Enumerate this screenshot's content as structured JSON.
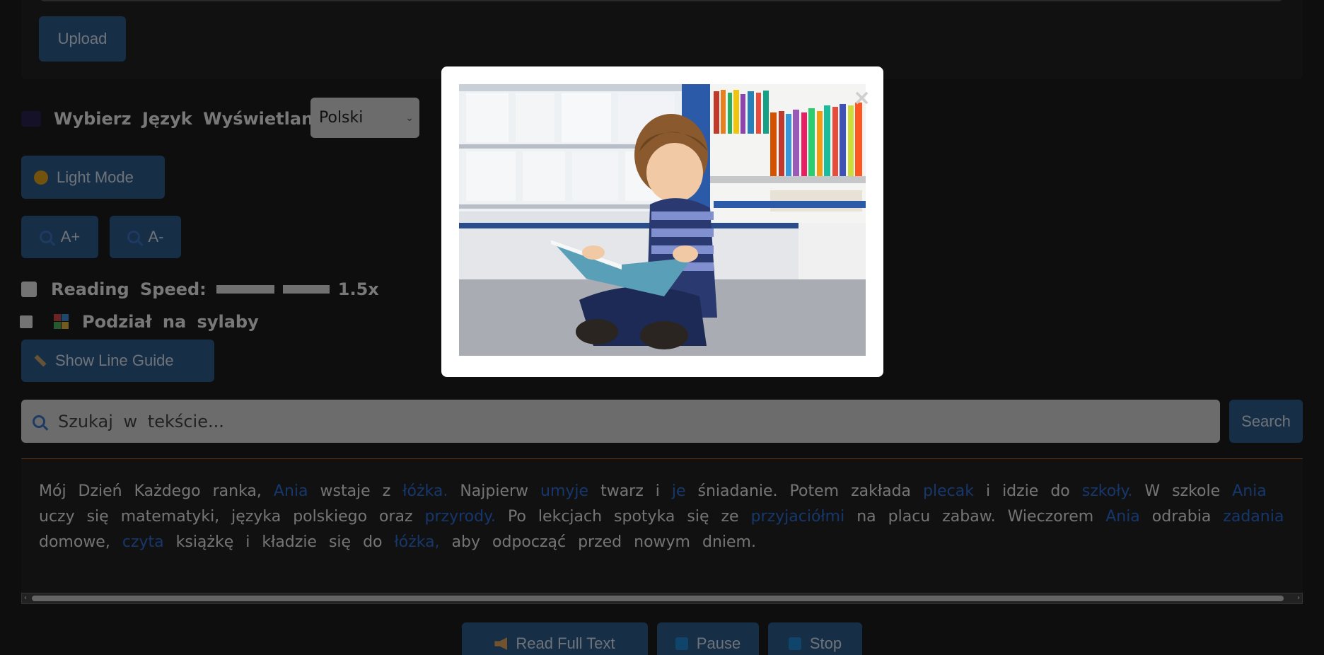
{
  "upload": {
    "button_label": "Upload"
  },
  "language": {
    "label": "Wybierz Język Wyświetlania:",
    "selected": "Polski"
  },
  "theme": {
    "button_label": "Light Mode"
  },
  "font_size": {
    "increase_label": "A+",
    "decrease_label": "A-"
  },
  "reading_speed": {
    "label": "Reading Speed:",
    "value_text": "1.5x",
    "level_fraction": 0.55
  },
  "syllables": {
    "label": "Podział na sylaby",
    "checked": false
  },
  "line_guide": {
    "button_label": "Show Line Guide"
  },
  "search": {
    "placeholder": "Szukaj w tekście...",
    "button_label": "Search"
  },
  "text_segments": [
    {
      "t": "Mój Dzień Każdego ranka, ",
      "h": false
    },
    {
      "t": "Ania",
      "h": true
    },
    {
      "t": " wstaje z ",
      "h": false
    },
    {
      "t": "łóżka.",
      "h": true
    },
    {
      "t": " Najpierw ",
      "h": false
    },
    {
      "t": "umyje",
      "h": true
    },
    {
      "t": " twarz i ",
      "h": false
    },
    {
      "t": "je",
      "h": true
    },
    {
      "t": " śniadanie. Potem zakłada ",
      "h": false
    },
    {
      "t": "plecak",
      "h": true
    },
    {
      "t": " i idzie do ",
      "h": false
    },
    {
      "t": "szkoły.",
      "h": true
    },
    {
      "t": " W szkole ",
      "h": false
    },
    {
      "t": "Ania",
      "h": true
    },
    {
      "t": " uczy się matematyki, języka polskiego oraz ",
      "h": false
    },
    {
      "t": "przyrody.",
      "h": true
    },
    {
      "t": " Po lekcjach spotyka się ze ",
      "h": false
    },
    {
      "t": "przyjaciółmi",
      "h": true
    },
    {
      "t": " na placu zabaw. Wieczorem ",
      "h": false
    },
    {
      "t": "Ania",
      "h": true
    },
    {
      "t": " odrabia ",
      "h": false
    },
    {
      "t": "zadania",
      "h": true
    },
    {
      "t": " domowe, ",
      "h": false
    },
    {
      "t": "czyta",
      "h": true
    },
    {
      "t": " książkę i kładzie się do ",
      "h": false
    },
    {
      "t": "łóżka,",
      "h": true
    },
    {
      "t": " aby odpocząć przed nowym dniem.",
      "h": false
    }
  ],
  "playback": {
    "read_label": "Read Full Text",
    "pause_label": "Pause",
    "stop_label": "Stop"
  },
  "modal": {
    "close_glyph": "×"
  },
  "colors": {
    "accent": "#2f5c8f",
    "highlight_word": "#2d6fd8",
    "sun": "#e5a418"
  }
}
